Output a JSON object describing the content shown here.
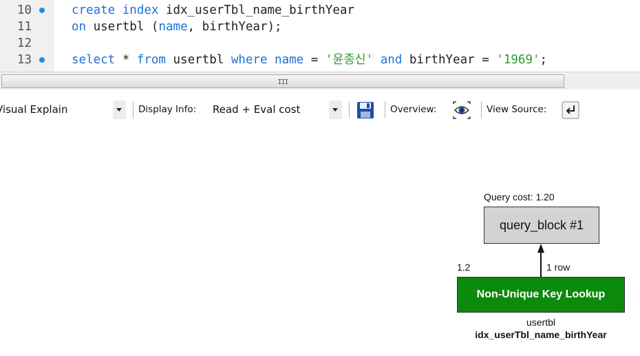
{
  "editor": {
    "lines": [
      {
        "number": "10",
        "breakpoint": true,
        "tokens": [
          {
            "t": "create",
            "k": "kw"
          },
          {
            "t": " "
          },
          {
            "t": "index",
            "k": "kw"
          },
          {
            "t": " idx_userTbl_name_birthYear"
          }
        ]
      },
      {
        "number": "11",
        "breakpoint": false,
        "tokens": [
          {
            "t": "on",
            "k": "kw"
          },
          {
            "t": " usertbl ("
          },
          {
            "t": "name",
            "k": "kw"
          },
          {
            "t": ", birthYear);"
          }
        ]
      },
      {
        "number": "12",
        "breakpoint": false,
        "tokens": []
      },
      {
        "number": "13",
        "breakpoint": true,
        "tokens": [
          {
            "t": "select",
            "k": "kw"
          },
          {
            "t": " * "
          },
          {
            "t": "from",
            "k": "kw"
          },
          {
            "t": " usertbl "
          },
          {
            "t": "where",
            "k": "kw"
          },
          {
            "t": " "
          },
          {
            "t": "name",
            "k": "kw"
          },
          {
            "t": " = "
          },
          {
            "t": "'윤종신'",
            "k": "str"
          },
          {
            "t": " "
          },
          {
            "t": "and",
            "k": "kw"
          },
          {
            "t": " birthYear = "
          },
          {
            "t": "'1969'",
            "k": "str"
          },
          {
            "t": ";"
          }
        ]
      }
    ],
    "scrollbar_grip": "III"
  },
  "toolbar": {
    "view_mode_value": "Visual Explain",
    "display_info_label": "Display Info:",
    "display_info_value": "Read + Eval cost",
    "overview_label": "Overview:",
    "view_source_label": "View Source:",
    "icons": {
      "save": "save-icon",
      "overview": "eye-icon",
      "view_source": "view-source-icon"
    }
  },
  "diagram": {
    "query_cost": "Query cost: 1.20",
    "query_block_label": "query_block #1",
    "edge_rows": "1 row",
    "lookup_cost": "1.2",
    "lookup_label": "Non-Unique Key Lookup",
    "table_name": "usertbl",
    "index_name": "idx_userTbl_name_birthYear",
    "colors": {
      "query_block_fill": "#d3d3d3",
      "lookup_fill": "#0b8a0b",
      "keyword": "#1e6fd9",
      "string": "#2f9a2f",
      "breakpoint": "#1e8ee8"
    }
  }
}
